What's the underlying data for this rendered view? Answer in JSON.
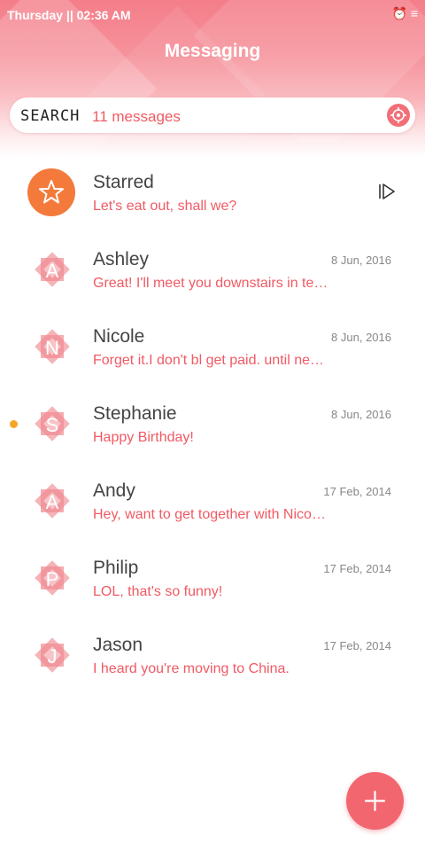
{
  "status": {
    "time": "Thursday || 02:36 AM",
    "icons": [
      "alarm-icon",
      "menu-lines-icon"
    ]
  },
  "header": {
    "title": "Messaging"
  },
  "search": {
    "label": "SEARCH",
    "count": "11 messages",
    "icon": "locate-icon"
  },
  "starred": {
    "name": "Starred",
    "preview": "Let's eat out, shall we?"
  },
  "conversations": [
    {
      "initial": "A",
      "name": "Ashley",
      "date": "8 Jun, 2016",
      "preview": "Great! I'll meet you downstairs in te…",
      "unread": false
    },
    {
      "initial": "N",
      "name": "Nicole",
      "date": "8 Jun, 2016",
      "preview": "Forget it.I don't bl get paid. until ne…",
      "unread": false
    },
    {
      "initial": "S",
      "name": "Stephanie",
      "date": "8 Jun, 2016",
      "preview": "Happy Birthday!",
      "unread": true
    },
    {
      "initial": "A",
      "name": "Andy",
      "date": "17 Feb, 2014",
      "preview": "Hey, want to get together with Nico…",
      "unread": false
    },
    {
      "initial": "P",
      "name": "Philip",
      "date": "17 Feb, 2014",
      "preview": "LOL, that's so funny!",
      "unread": false
    },
    {
      "initial": "J",
      "name": "Jason",
      "date": "17 Feb, 2014",
      "preview": "I heard you're moving to China.",
      "unread": false
    }
  ],
  "colors": {
    "accent": "#f05a64",
    "starred_avatar": "#f47a3b",
    "unread_dot": "#f5a623",
    "fab": "#f26670"
  }
}
